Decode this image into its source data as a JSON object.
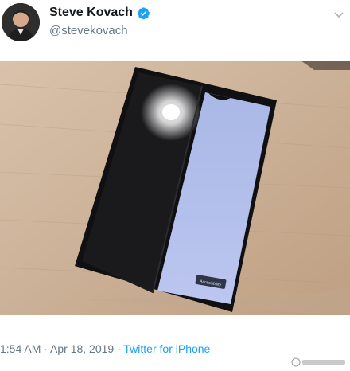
{
  "tweet": {
    "display_name": "Steve Kovach",
    "handle": "@stevekovach",
    "verified": true,
    "timestamp": "1:54 AM · Apr 18, 2019 · ",
    "source": "Twitter for iPhone"
  },
  "media": {
    "phone_screen_button": "Accessibility"
  },
  "icons": {
    "verified": "verified-badge-icon",
    "chevron": "chevron-down-icon"
  },
  "colors": {
    "verified_blue": "#1da1f2",
    "secondary_text": "#657786"
  }
}
